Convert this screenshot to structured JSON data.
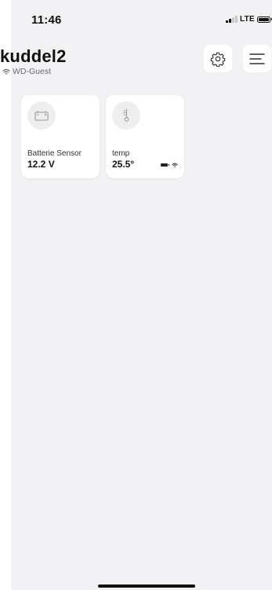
{
  "status_bar": {
    "time": "11:46",
    "network": "LTE"
  },
  "header": {
    "title": "kuddel2",
    "network_name": "WD-Guest",
    "icons": {
      "network": "wifi-icon",
      "settings": "gear-icon",
      "menu": "hamburger-menu-icon"
    }
  },
  "devices": [
    {
      "name": "Batterie Sensor",
      "value": "12.2 V",
      "icon": "car-battery-icon"
    },
    {
      "name": "temp",
      "value": "25.5°",
      "icon": "thermometer-icon",
      "status_icons": [
        "battery-icon",
        "wifi-icon"
      ]
    }
  ],
  "colors": {
    "background": "#f2f2f4",
    "card": "#ffffff",
    "icon_circle": "#eeeeef",
    "secondary_text": "#6b6b70"
  }
}
